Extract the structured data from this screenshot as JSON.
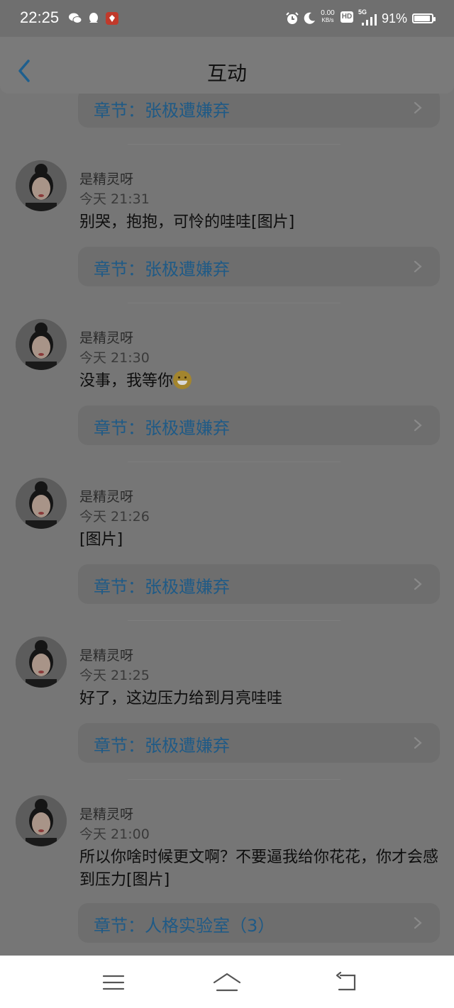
{
  "status_bar": {
    "time": "22:25",
    "network_speed_value": "0.00",
    "network_speed_unit": "KB/s",
    "hd_label": "HD",
    "signal_label": "5G",
    "battery_percent": "91%",
    "battery_level": 0.91
  },
  "header": {
    "title": "互动"
  },
  "partial_item": {
    "chapter_label": "章节：张极遭嫌弃"
  },
  "items": [
    {
      "name": "是精灵呀",
      "time": "今天 21:31",
      "message": "别哭，抱抱，可怜的哇哇[图片]",
      "chapter_label": "章节：张极遭嫌弃"
    },
    {
      "name": "是精灵呀",
      "time": "今天 21:30",
      "message": "没事，我等你",
      "emoji": "grin-emoji",
      "chapter_label": "章节：张极遭嫌弃"
    },
    {
      "name": "是精灵呀",
      "time": "今天 21:26",
      "message": "[图片]",
      "chapter_label": "章节：张极遭嫌弃"
    },
    {
      "name": "是精灵呀",
      "time": "今天 21:25",
      "message": "好了，这边压力给到月亮哇哇",
      "chapter_label": "章节：张极遭嫌弃"
    },
    {
      "name": "是精灵呀",
      "time": "今天 21:00",
      "message": "所以你啥时候更文啊？不要逼我给你花花，你才会感到压力[图片]",
      "chapter_label": "章节：人格实验室（3）"
    }
  ],
  "nav": {
    "icons": [
      "menu-icon",
      "home-icon",
      "back-icon"
    ]
  }
}
